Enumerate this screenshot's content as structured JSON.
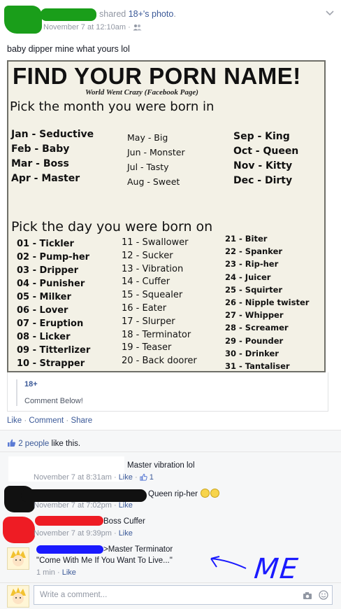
{
  "post": {
    "shared_text": "shared",
    "shared_link": "18+'s photo",
    "period": ".",
    "timestamp": "November 7 at 12:10am",
    "separator": "·",
    "caption": "baby dipper mine what yours lol"
  },
  "poster": {
    "title": "FIND YOUR PORN NAME!",
    "subtitle": "World Went Crazy (Facebook Page)",
    "month_heading": "Pick the month you were born in",
    "months_col1": [
      "Jan - Seductive",
      "Feb - Baby",
      "Mar - Boss",
      "Apr - Master"
    ],
    "months_col2": [
      "May - Big",
      "Jun - Monster",
      "Jul - Tasty",
      "Aug - Sweet"
    ],
    "months_col3": [
      "Sep - King",
      "Oct - Queen",
      "Nov - Kitty",
      "Dec - Dirty"
    ],
    "day_heading": "Pick the day you were born on",
    "days_col1": [
      "01 - Tickler",
      "02 - Pump-her",
      "03 - Dripper",
      "04 - Punisher",
      "05 - Milker",
      "06 - Lover",
      "07 - Eruption",
      "08 - Licker",
      "09 - Titterlizer",
      "10 - Strapper"
    ],
    "days_col2": [
      "11 - Swallower",
      "12 - Sucker",
      "13 - Vibration",
      "14 - Cuffer",
      "15 - Squealer",
      "16 - Eater",
      "17 - Slurper",
      "18 - Terminator",
      "19 - Teaser",
      "20 - Back doorer"
    ],
    "days_col3": [
      "21 - Biter",
      "22 - Spanker",
      "23 - Rip-her",
      "24 - Juicer",
      "25 - Squirter",
      "26 - Nipple twister",
      "27 - Whipper",
      "28 - Screamer",
      "29 - Pounder",
      "30 - Drinker",
      "31 - Tantaliser"
    ]
  },
  "shared_box": {
    "page_name": "18+",
    "text": "Comment Below!"
  },
  "actions": {
    "like": "Like",
    "comment": "Comment",
    "share": "Share",
    "separator": "·"
  },
  "likes_summary": {
    "count_text": "2 people",
    "suffix": "like this."
  },
  "comments": [
    {
      "text": "Master vibration lol",
      "time": "November 7 at 8:31am",
      "like": "Like",
      "like_count": "1"
    },
    {
      "text": "Queen rip-her",
      "time": "November 7 at 7:02pm",
      "like": "Like"
    },
    {
      "text": "Boss Cuffer",
      "time": "November 7 at 9:39pm",
      "like": "Like"
    },
    {
      "text": ">Master Terminator",
      "quote": "\"Come With Me If You Want To Live...\"",
      "time": "1 min",
      "like": "Like"
    }
  ],
  "annotation": {
    "text": "ME"
  },
  "composer": {
    "placeholder": "Write a comment..."
  },
  "colors": {
    "link": "#3b5998",
    "meta": "#9197a3",
    "scribble_green": "#1a9e1a",
    "scribble_black": "#111111",
    "scribble_red": "#ee1c24",
    "scribble_blue": "#1a1aff"
  },
  "icons": [
    "chevron-down-icon",
    "audience-icon",
    "thumbs-up-icon",
    "camera-icon",
    "smiley-icon",
    "arrow-annotation-icon"
  ]
}
